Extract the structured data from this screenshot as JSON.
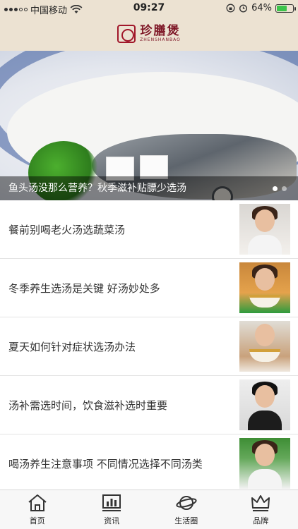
{
  "status_bar": {
    "carrier": "中国移动",
    "time": "09:27",
    "battery_percent": "64%",
    "battery_level": 0.64,
    "wifi_icon": "wifi-icon",
    "alarm_icon": "alarm-icon",
    "lock_icon": "rotation-lock-icon"
  },
  "header": {
    "logo_cn": "珍膳煲",
    "logo_en": "ZHENSHANBAO"
  },
  "banner": {
    "caption": "鱼头汤没那么营养？秋季滋补贴膘少选汤",
    "page_count": 2,
    "active_index": 0
  },
  "articles": [
    {
      "title": "餐前别喝老火汤选蔬菜汤"
    },
    {
      "title": "冬季养生选汤是关键 好汤妙处多"
    },
    {
      "title": "夏天如何针对症状选汤办法"
    },
    {
      "title": "汤补需选时间，饮食滋补选时重要"
    },
    {
      "title": "喝汤养生注意事项 不同情况选择不同汤类"
    }
  ],
  "tabs": [
    {
      "label": "首页",
      "icon": "home-icon"
    },
    {
      "label": "资讯",
      "icon": "news-chart-icon"
    },
    {
      "label": "生活圈",
      "icon": "planet-icon"
    },
    {
      "label": "品牌",
      "icon": "crown-icon"
    }
  ],
  "colors": {
    "header_bg": "#ece2d2",
    "brand_red": "#a1172a",
    "battery_green": "#3cc44b"
  }
}
